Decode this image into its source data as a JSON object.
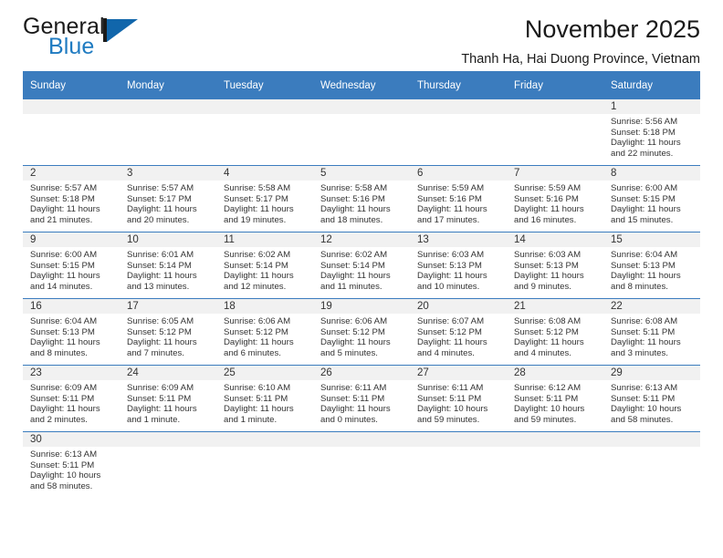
{
  "brand": {
    "name_top": "General",
    "name_bottom": "Blue",
    "mark": "triangle-logo"
  },
  "header": {
    "title": "November 2025",
    "subtitle": "Thanh Ha, Hai Duong Province, Vietnam"
  },
  "colors": {
    "header_blue": "#3b7cbe",
    "brand_blue": "#1f7bc1",
    "daynum_band": "#f1f1f1",
    "text": "#333333"
  },
  "calendar": {
    "weekday_headers": [
      "Sunday",
      "Monday",
      "Tuesday",
      "Wednesday",
      "Thursday",
      "Friday",
      "Saturday"
    ],
    "weeks": [
      [
        {
          "day": "",
          "lines": [
            "",
            "",
            "",
            ""
          ]
        },
        {
          "day": "",
          "lines": [
            "",
            "",
            "",
            ""
          ]
        },
        {
          "day": "",
          "lines": [
            "",
            "",
            "",
            ""
          ]
        },
        {
          "day": "",
          "lines": [
            "",
            "",
            "",
            ""
          ]
        },
        {
          "day": "",
          "lines": [
            "",
            "",
            "",
            ""
          ]
        },
        {
          "day": "",
          "lines": [
            "",
            "",
            "",
            ""
          ]
        },
        {
          "day": "1",
          "lines": [
            "Sunrise: 5:56 AM",
            "Sunset: 5:18 PM",
            "Daylight: 11 hours",
            "and 22 minutes."
          ]
        }
      ],
      [
        {
          "day": "2",
          "lines": [
            "Sunrise: 5:57 AM",
            "Sunset: 5:18 PM",
            "Daylight: 11 hours",
            "and 21 minutes."
          ]
        },
        {
          "day": "3",
          "lines": [
            "Sunrise: 5:57 AM",
            "Sunset: 5:17 PM",
            "Daylight: 11 hours",
            "and 20 minutes."
          ]
        },
        {
          "day": "4",
          "lines": [
            "Sunrise: 5:58 AM",
            "Sunset: 5:17 PM",
            "Daylight: 11 hours",
            "and 19 minutes."
          ]
        },
        {
          "day": "5",
          "lines": [
            "Sunrise: 5:58 AM",
            "Sunset: 5:16 PM",
            "Daylight: 11 hours",
            "and 18 minutes."
          ]
        },
        {
          "day": "6",
          "lines": [
            "Sunrise: 5:59 AM",
            "Sunset: 5:16 PM",
            "Daylight: 11 hours",
            "and 17 minutes."
          ]
        },
        {
          "day": "7",
          "lines": [
            "Sunrise: 5:59 AM",
            "Sunset: 5:16 PM",
            "Daylight: 11 hours",
            "and 16 minutes."
          ]
        },
        {
          "day": "8",
          "lines": [
            "Sunrise: 6:00 AM",
            "Sunset: 5:15 PM",
            "Daylight: 11 hours",
            "and 15 minutes."
          ]
        }
      ],
      [
        {
          "day": "9",
          "lines": [
            "Sunrise: 6:00 AM",
            "Sunset: 5:15 PM",
            "Daylight: 11 hours",
            "and 14 minutes."
          ]
        },
        {
          "day": "10",
          "lines": [
            "Sunrise: 6:01 AM",
            "Sunset: 5:14 PM",
            "Daylight: 11 hours",
            "and 13 minutes."
          ]
        },
        {
          "day": "11",
          "lines": [
            "Sunrise: 6:02 AM",
            "Sunset: 5:14 PM",
            "Daylight: 11 hours",
            "and 12 minutes."
          ]
        },
        {
          "day": "12",
          "lines": [
            "Sunrise: 6:02 AM",
            "Sunset: 5:14 PM",
            "Daylight: 11 hours",
            "and 11 minutes."
          ]
        },
        {
          "day": "13",
          "lines": [
            "Sunrise: 6:03 AM",
            "Sunset: 5:13 PM",
            "Daylight: 11 hours",
            "and 10 minutes."
          ]
        },
        {
          "day": "14",
          "lines": [
            "Sunrise: 6:03 AM",
            "Sunset: 5:13 PM",
            "Daylight: 11 hours",
            "and 9 minutes."
          ]
        },
        {
          "day": "15",
          "lines": [
            "Sunrise: 6:04 AM",
            "Sunset: 5:13 PM",
            "Daylight: 11 hours",
            "and 8 minutes."
          ]
        }
      ],
      [
        {
          "day": "16",
          "lines": [
            "Sunrise: 6:04 AM",
            "Sunset: 5:13 PM",
            "Daylight: 11 hours",
            "and 8 minutes."
          ]
        },
        {
          "day": "17",
          "lines": [
            "Sunrise: 6:05 AM",
            "Sunset: 5:12 PM",
            "Daylight: 11 hours",
            "and 7 minutes."
          ]
        },
        {
          "day": "18",
          "lines": [
            "Sunrise: 6:06 AM",
            "Sunset: 5:12 PM",
            "Daylight: 11 hours",
            "and 6 minutes."
          ]
        },
        {
          "day": "19",
          "lines": [
            "Sunrise: 6:06 AM",
            "Sunset: 5:12 PM",
            "Daylight: 11 hours",
            "and 5 minutes."
          ]
        },
        {
          "day": "20",
          "lines": [
            "Sunrise: 6:07 AM",
            "Sunset: 5:12 PM",
            "Daylight: 11 hours",
            "and 4 minutes."
          ]
        },
        {
          "day": "21",
          "lines": [
            "Sunrise: 6:08 AM",
            "Sunset: 5:12 PM",
            "Daylight: 11 hours",
            "and 4 minutes."
          ]
        },
        {
          "day": "22",
          "lines": [
            "Sunrise: 6:08 AM",
            "Sunset: 5:11 PM",
            "Daylight: 11 hours",
            "and 3 minutes."
          ]
        }
      ],
      [
        {
          "day": "23",
          "lines": [
            "Sunrise: 6:09 AM",
            "Sunset: 5:11 PM",
            "Daylight: 11 hours",
            "and 2 minutes."
          ]
        },
        {
          "day": "24",
          "lines": [
            "Sunrise: 6:09 AM",
            "Sunset: 5:11 PM",
            "Daylight: 11 hours",
            "and 1 minute."
          ]
        },
        {
          "day": "25",
          "lines": [
            "Sunrise: 6:10 AM",
            "Sunset: 5:11 PM",
            "Daylight: 11 hours",
            "and 1 minute."
          ]
        },
        {
          "day": "26",
          "lines": [
            "Sunrise: 6:11 AM",
            "Sunset: 5:11 PM",
            "Daylight: 11 hours",
            "and 0 minutes."
          ]
        },
        {
          "day": "27",
          "lines": [
            "Sunrise: 6:11 AM",
            "Sunset: 5:11 PM",
            "Daylight: 10 hours",
            "and 59 minutes."
          ]
        },
        {
          "day": "28",
          "lines": [
            "Sunrise: 6:12 AM",
            "Sunset: 5:11 PM",
            "Daylight: 10 hours",
            "and 59 minutes."
          ]
        },
        {
          "day": "29",
          "lines": [
            "Sunrise: 6:13 AM",
            "Sunset: 5:11 PM",
            "Daylight: 10 hours",
            "and 58 minutes."
          ]
        }
      ],
      [
        {
          "day": "30",
          "lines": [
            "Sunrise: 6:13 AM",
            "Sunset: 5:11 PM",
            "Daylight: 10 hours",
            "and 58 minutes."
          ]
        },
        {
          "day": "",
          "lines": [
            "",
            "",
            "",
            ""
          ]
        },
        {
          "day": "",
          "lines": [
            "",
            "",
            "",
            ""
          ]
        },
        {
          "day": "",
          "lines": [
            "",
            "",
            "",
            ""
          ]
        },
        {
          "day": "",
          "lines": [
            "",
            "",
            "",
            ""
          ]
        },
        {
          "day": "",
          "lines": [
            "",
            "",
            "",
            ""
          ]
        },
        {
          "day": "",
          "lines": [
            "",
            "",
            "",
            ""
          ]
        }
      ]
    ]
  }
}
